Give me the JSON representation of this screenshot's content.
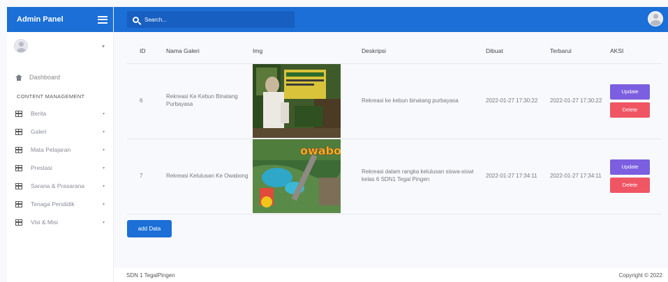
{
  "brand": {
    "title": "Admin Panel"
  },
  "sidebar": {
    "user_caret": "▾",
    "dashboard": "Dashboard",
    "section_title": "CONTENT MANAGEMENT",
    "items": [
      {
        "label": "Berita"
      },
      {
        "label": "Galeri"
      },
      {
        "label": "Mata Pelajaran"
      },
      {
        "label": "Prestasi"
      },
      {
        "label": "Sarana & Prasarana"
      },
      {
        "label": "Tenaga Pendidik"
      },
      {
        "label": "Visi & Misi"
      }
    ],
    "chevron": "▾"
  },
  "topbar": {
    "search_placeholder": "Search..."
  },
  "table": {
    "headers": {
      "id": "ID",
      "nama": "Nama Galeri",
      "img": "Img",
      "deskripsi": "Deskripsi",
      "dibuat": "Dibuat",
      "terbarui": "Terbarui",
      "aksi": "AKSI"
    },
    "rows": [
      {
        "id": "6",
        "nama": "Rekreasi Ke Kebun Binatang Purbayasa",
        "deskripsi": "Rekreasi ke kebun binatang purbayasa",
        "dibuat": "2022-01-27 17:30:22",
        "terbarui": "2022-01-27 17:30:22",
        "update_label": "Update",
        "delete_label": "Delete"
      },
      {
        "id": "7",
        "nama": "Rekreasi Kelulusan Ke Owabong",
        "deskripsi": "Rekreasi dalam rangka kelulusan siswa-siswi kelas 6 SDN1 Tegal Pingen",
        "dibuat": "2022-01-27 17:34:11",
        "terbarui": "2022-01-27 17:34:11",
        "update_label": "Update",
        "delete_label": "Delete",
        "img_logo_text": "owabong"
      }
    ]
  },
  "add_button": "add Data",
  "footer": {
    "left": "SDN 1 TegalPingen",
    "right": "Copyright © 2022"
  },
  "colors": {
    "primary": "#1b6fd6",
    "update": "#7b5fe0",
    "delete": "#ef5563"
  }
}
